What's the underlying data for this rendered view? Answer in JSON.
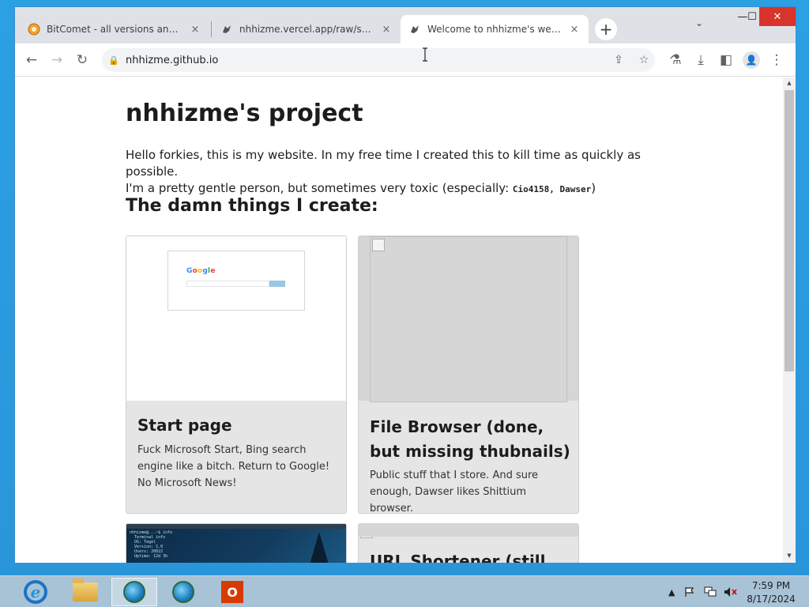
{
  "tabs": [
    {
      "title": "BitComet - all versions and zip p",
      "active": false
    },
    {
      "title": "nhhizme.vercel.app/raw/shit.txt",
      "active": false
    },
    {
      "title": "Welcome to nhhizme's website!",
      "active": true
    }
  ],
  "icons": {
    "tab_close": "×",
    "new_tab": "+",
    "tab_search": "⌄",
    "minimize": "—",
    "maximize": "☐",
    "close": "✕",
    "back": "←",
    "forward": "→",
    "reload": "↻",
    "lock": "🔒",
    "share": "⇪",
    "star": "☆",
    "labs": "⚗",
    "download": "⤓",
    "side_panel": "◧",
    "profile": "👤",
    "menu": "⋮",
    "scroll_up": "▲",
    "scroll_down": "▼"
  },
  "address_bar": {
    "url": "nhhizme.github.io"
  },
  "page": {
    "title": "nhhizme's project",
    "intro_line1": "Hello forkies, this is my website. In my free time I created this to kill time as quickly as possible.",
    "intro_line2_prefix": "I'm a pretty gentle person, but sometimes very toxic (especially: ",
    "intro_line2_code": "Cio4158, Dawser",
    "intro_line2_suffix": ")",
    "section_heading": "The damn things I create:",
    "cards": [
      {
        "title": "Start page",
        "description": "Fuck Microsoft Start, Bing search engine like a bitch. Return to Google! No Microsoft News!",
        "thumb_logo": "Google"
      },
      {
        "title": "File Browser (done, but missing thubnails)",
        "description": "Public stuff that I store. And sure enough, Dawser likes Shittium browser."
      },
      {
        "title": "",
        "description": "",
        "thumb_text": "nhhizme@...~$ info\n  Terminal info\n  OS: Tegel\n  Version: 1.0\n  Users: 20022\n  Uptime: 12d 3h"
      },
      {
        "title": "URL Shortener (still",
        "description": ""
      }
    ]
  },
  "taskbar": {
    "clock_time": "7:59 PM",
    "clock_date": "8/17/2024"
  },
  "colors": {
    "accent": "#1a73e8",
    "window_close": "#d9342b",
    "card_bg": "#e5e5e5",
    "office": "#d83b01"
  }
}
